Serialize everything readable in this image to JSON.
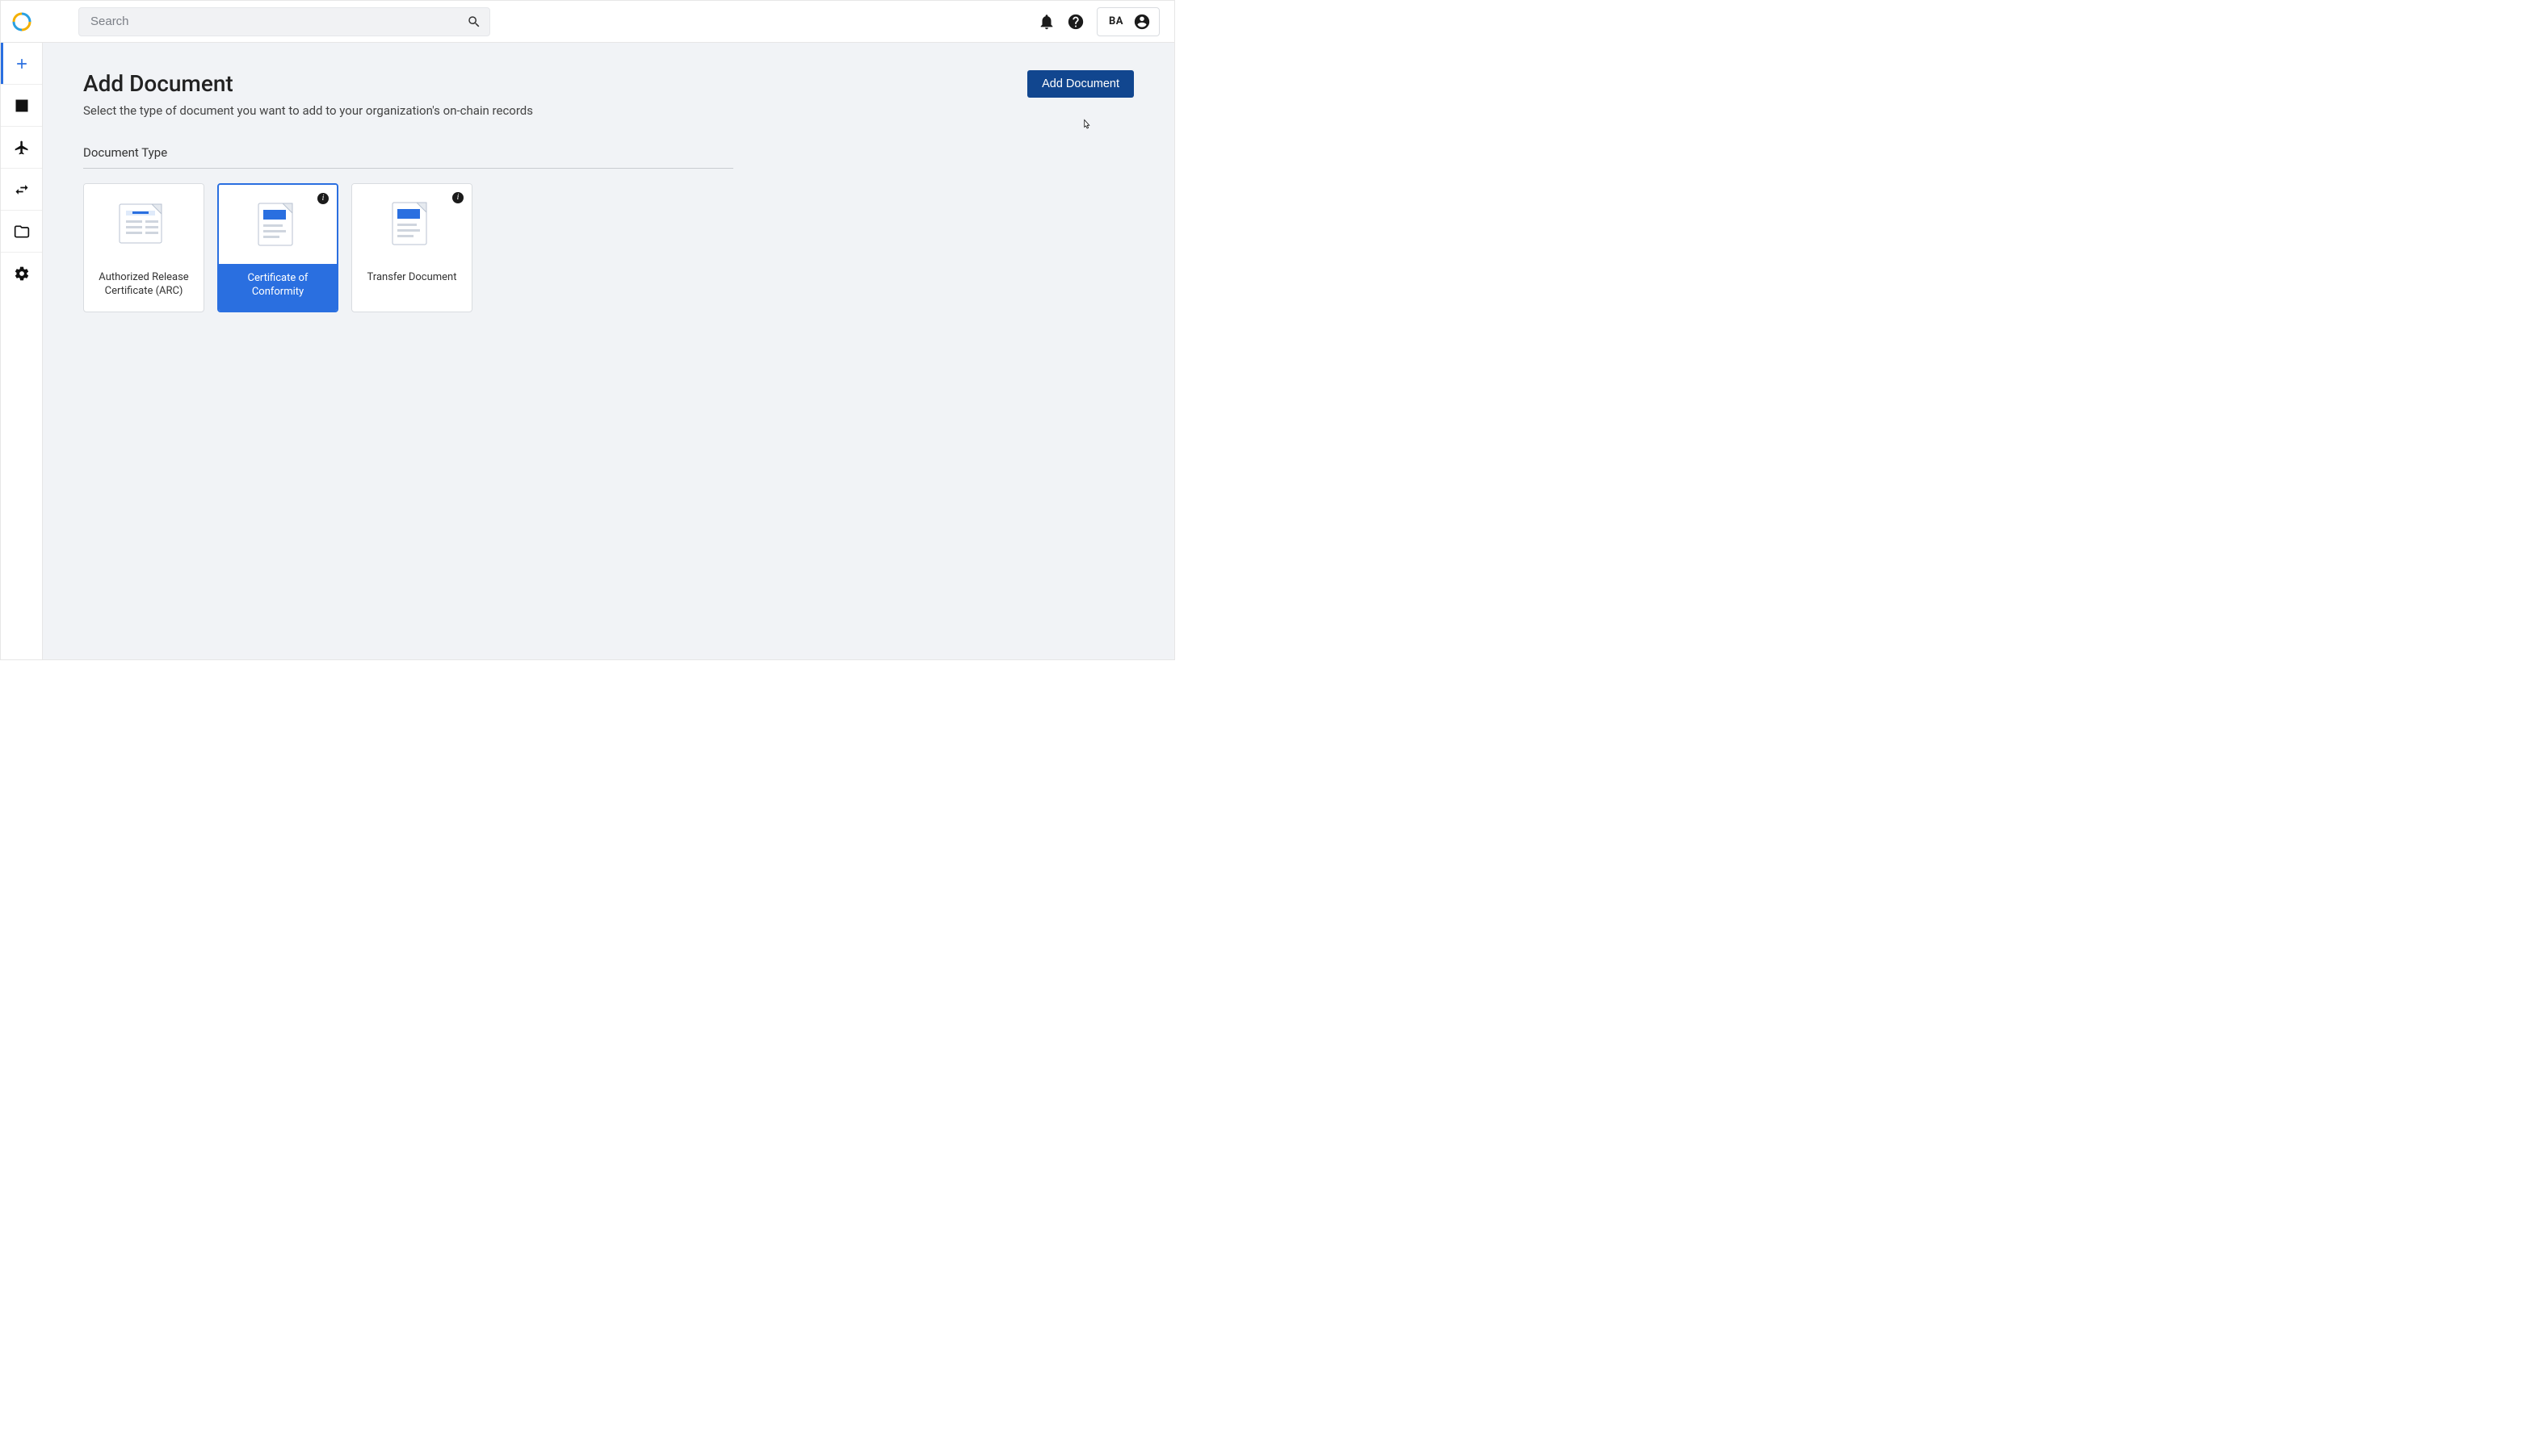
{
  "header": {
    "search_placeholder": "Search",
    "user_initials": "BA"
  },
  "sidebar": {
    "items": [
      {
        "key": "add",
        "icon": "plus-icon",
        "active": true
      },
      {
        "key": "dashboard",
        "icon": "chart-icon",
        "active": false
      },
      {
        "key": "flights",
        "icon": "airplane-icon",
        "active": false
      },
      {
        "key": "transfers",
        "icon": "swap-icon",
        "active": false
      },
      {
        "key": "files",
        "icon": "folder-icon",
        "active": false
      },
      {
        "key": "settings",
        "icon": "gear-icon",
        "active": false
      }
    ]
  },
  "page": {
    "title": "Add Document",
    "subtitle": "Select the type of document you want to add to your organization's on-chain records",
    "primary_button": "Add Document",
    "section_label": "Document Type"
  },
  "doc_types": [
    {
      "label": "Authorized Release Certificate (ARC)",
      "selected": false,
      "has_info": false
    },
    {
      "label": "Certificate of Conformity",
      "selected": true,
      "has_info": true
    },
    {
      "label": "Transfer Document",
      "selected": false,
      "has_info": true
    }
  ],
  "colors": {
    "accent": "#2a6fe0",
    "primary_button": "#11468f",
    "page_bg": "#f1f3f6"
  }
}
